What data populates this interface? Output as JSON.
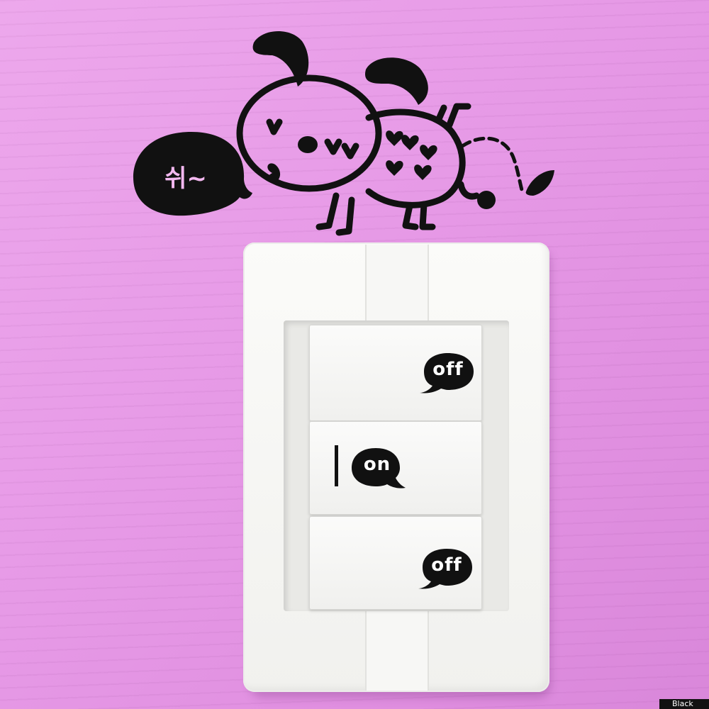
{
  "scene": {
    "wall_color": "#e79be7",
    "sticker_color": "#111111",
    "plate_color": "#f7f7f5"
  },
  "sticker": {
    "speech_text": "쉬~"
  },
  "switches": [
    {
      "label": "off"
    },
    {
      "label": "on",
      "active": true
    },
    {
      "label": "off"
    }
  ],
  "watermark": {
    "text": "Black"
  }
}
